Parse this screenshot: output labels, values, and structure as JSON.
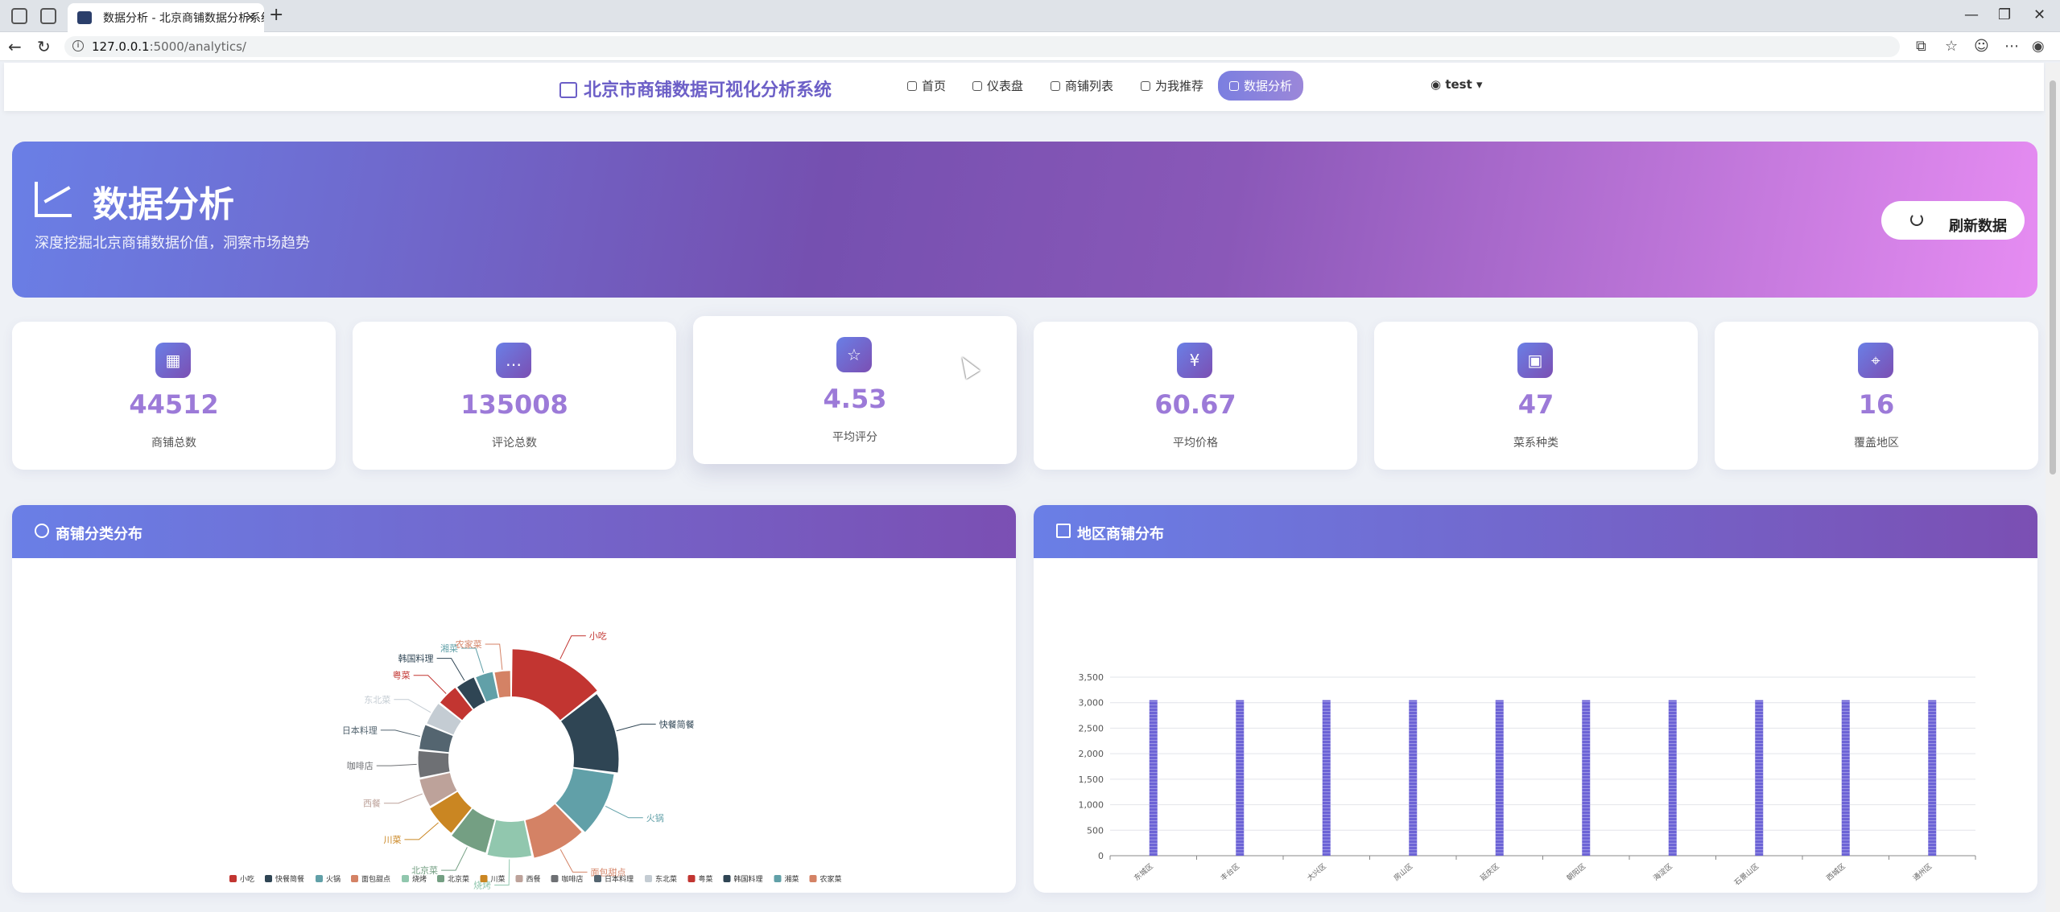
{
  "browser": {
    "tab_title": "数据分析 - 北京商铺数据分析系统",
    "url_host": "127.0.0.1",
    "url_path": ":5000/analytics/"
  },
  "navbar": {
    "brand": "北京市商铺数据可视化分析系统",
    "items": [
      {
        "label": "首页",
        "icon": "home-icon"
      },
      {
        "label": "仪表盘",
        "icon": "gauge-icon"
      },
      {
        "label": "商铺列表",
        "icon": "store-icon"
      },
      {
        "label": "为我推荐",
        "icon": "lightbulb-icon"
      },
      {
        "label": "数据分析",
        "icon": "chart-line-icon",
        "active": true
      }
    ],
    "user": "test"
  },
  "hero": {
    "title": "数据分析",
    "subtitle": "深度挖掘北京商铺数据价值，洞察市场趋势",
    "refresh_label": "刷新数据"
  },
  "stats": [
    {
      "value": "44512",
      "label": "商铺总数",
      "icon": "store-icon"
    },
    {
      "value": "135008",
      "label": "评论总数",
      "icon": "comment-icon"
    },
    {
      "value": "4.53",
      "label": "平均评分",
      "icon": "star-icon"
    },
    {
      "value": "60.67",
      "label": "平均价格",
      "icon": "yen-icon"
    },
    {
      "value": "47",
      "label": "菜系种类",
      "icon": "grid-icon"
    },
    {
      "value": "16",
      "label": "覆盖地区",
      "icon": "map-pin-icon"
    }
  ],
  "panels": {
    "category_title": "商铺分类分布",
    "district_title": "地区商铺分布"
  },
  "chart_data": [
    {
      "type": "pie",
      "variant": "rose",
      "categories": [
        "小吃",
        "快餐简餐",
        "火锅",
        "面包甜点",
        "烧烤",
        "北京菜",
        "川菜",
        "西餐",
        "咖啡店",
        "日本料理",
        "东北菜",
        "粤菜",
        "韩国料理",
        "湘菜",
        "农家菜"
      ],
      "values": [
        100,
        88,
        72,
        62,
        52,
        46,
        40,
        36,
        34,
        32,
        30,
        28,
        26,
        24,
        22
      ],
      "colors": [
        "#c23531",
        "#2f4554",
        "#61a0a8",
        "#d48265",
        "#91c7ae",
        "#749f83",
        "#ca8622",
        "#bda29a",
        "#6e7074",
        "#546570",
        "#c4ccd3",
        "#c23531",
        "#2f4554",
        "#61a0a8",
        "#d48265"
      ],
      "legend": "bottom"
    },
    {
      "type": "bar",
      "categories": [
        "东城区",
        "丰台区",
        "大兴区",
        "房山区",
        "延庆区",
        "朝阳区",
        "海淀区",
        "石景山区",
        "西城区",
        "通州区"
      ],
      "values": [
        3050,
        3050,
        3050,
        3050,
        3050,
        3050,
        3050,
        3050,
        3050,
        3050
      ],
      "ylim": [
        0,
        3500
      ],
      "yticks": [
        0,
        500,
        1000,
        1500,
        2000,
        2500,
        3000,
        3500
      ],
      "ytick_labels": [
        "0",
        "500",
        "1,000",
        "1,500",
        "2,000",
        "2,500",
        "3,000",
        "3,500"
      ],
      "grid": true,
      "bar_color": "#6c63d6"
    }
  ]
}
